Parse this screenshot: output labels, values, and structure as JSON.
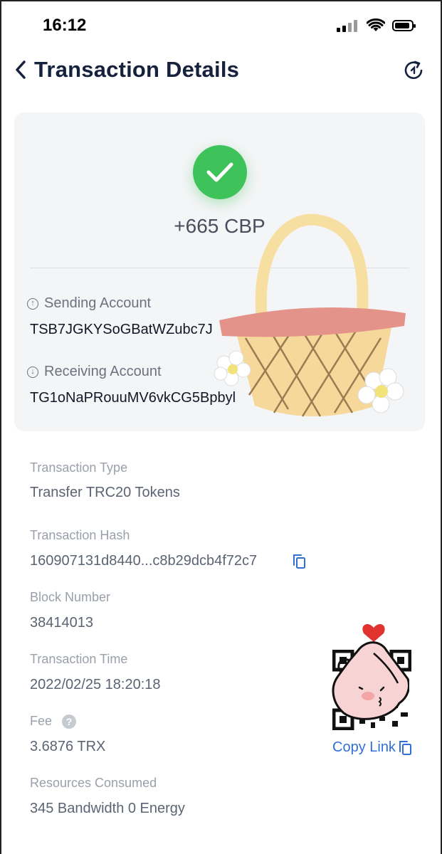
{
  "status": {
    "time": "16:12"
  },
  "header": {
    "title": "Transaction Details"
  },
  "summary": {
    "amount": "+665 CBP",
    "sending_label": "Sending Account",
    "sending_value": "TSB7JGKYSoGBatWZubc7J",
    "receiving_label": "Receiving Account",
    "receiving_value": "TG1oNaPRouuMV6vkCG5Bpbyl"
  },
  "details": {
    "type_label": "Transaction Type",
    "type_value": "Transfer TRC20 Tokens",
    "hash_label": "Transaction Hash",
    "hash_value": "160907131d8440...c8b29dcb4f72c7",
    "block_label": "Block Number",
    "block_value": "38414013",
    "time_label": "Transaction Time",
    "time_value": "2022/02/25 18:20:18",
    "fee_label": "Fee",
    "fee_help": "?",
    "fee_value": "3.6876 TRX",
    "resources_label": "Resources Consumed",
    "resources_value": "345 Bandwidth  0 Energy",
    "copy_link": "Copy Link"
  },
  "colors": {
    "success": "#3ec25a",
    "accent": "#2f6fd6",
    "title": "#15213d"
  },
  "icons": [
    "back-chevron-icon",
    "refresh-icon",
    "check-icon",
    "arrow-up-circle-icon",
    "arrow-down-circle-icon",
    "copy-icon",
    "help-icon"
  ]
}
